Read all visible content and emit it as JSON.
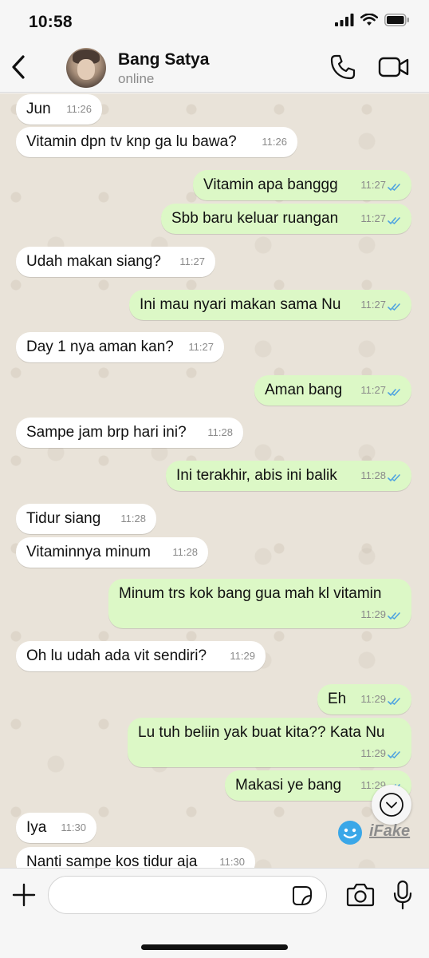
{
  "status_bar": {
    "time": "10:58"
  },
  "header": {
    "back_icon": "chevron-left-icon",
    "contact_name": "Bang Satya",
    "contact_status": "online",
    "call_icon": "phone-icon",
    "video_icon": "video-camera-icon"
  },
  "colors": {
    "incoming_bubble": "#ffffff",
    "outgoing_bubble": "#dcf8c6",
    "chat_background": "#e9e3d9",
    "read_ticks": "#4fa3e0"
  },
  "messages": [
    {
      "direction": "in",
      "text": "Jun",
      "time": "11:26"
    },
    {
      "direction": "in",
      "text": "Vitamin dpn tv knp ga lu bawa?",
      "time": "11:26"
    },
    {
      "direction": "out",
      "text": "Vitamin apa banggg",
      "time": "11:27",
      "status": "read"
    },
    {
      "direction": "out",
      "text": "Sbb baru keluar ruangan",
      "time": "11:27",
      "status": "read"
    },
    {
      "direction": "in",
      "text": "Udah makan siang?",
      "time": "11:27"
    },
    {
      "direction": "out",
      "text": "Ini mau nyari makan sama Nu",
      "time": "11:27",
      "status": "read"
    },
    {
      "direction": "in",
      "text": "Day 1 nya aman kan?",
      "time": "11:27"
    },
    {
      "direction": "out",
      "text": "Aman bang",
      "time": "11:27",
      "status": "read"
    },
    {
      "direction": "in",
      "text": "Sampe jam brp hari ini?",
      "time": "11:28"
    },
    {
      "direction": "out",
      "text": "Ini terakhir, abis ini balik",
      "time": "11:28",
      "status": "read"
    },
    {
      "direction": "in",
      "text": "Tidur siang",
      "time": "11:28"
    },
    {
      "direction": "in",
      "text": "Vitaminnya minum",
      "time": "11:28"
    },
    {
      "direction": "out",
      "text": "Minum trs kok bang gua mah kl vitamin",
      "time": "11:29",
      "status": "read"
    },
    {
      "direction": "in",
      "text": "Oh lu udah ada vit sendiri?",
      "time": "11:29"
    },
    {
      "direction": "out",
      "text": "Eh",
      "time": "11:29",
      "status": "read"
    },
    {
      "direction": "out",
      "text": "Lu tuh beliin yak buat kita?? Kata Nu",
      "time": "11:29",
      "status": "read"
    },
    {
      "direction": "out",
      "text": "Makasi ye bang",
      "time": "11:29",
      "status": "read"
    },
    {
      "direction": "in",
      "text": "Iya",
      "time": "11:30"
    },
    {
      "direction": "in",
      "text": "Nanti sampe kos tidur aja",
      "time": "11:30"
    }
  ],
  "scroll_down_icon": "chevron-down-circle-icon",
  "watermark": {
    "text": "iFake",
    "icon": "ifake-logo-icon"
  },
  "input_bar": {
    "attach_icon": "plus-icon",
    "message_placeholder": "",
    "sticker_icon": "sticker-icon",
    "camera_icon": "camera-icon",
    "mic_icon": "microphone-icon"
  }
}
